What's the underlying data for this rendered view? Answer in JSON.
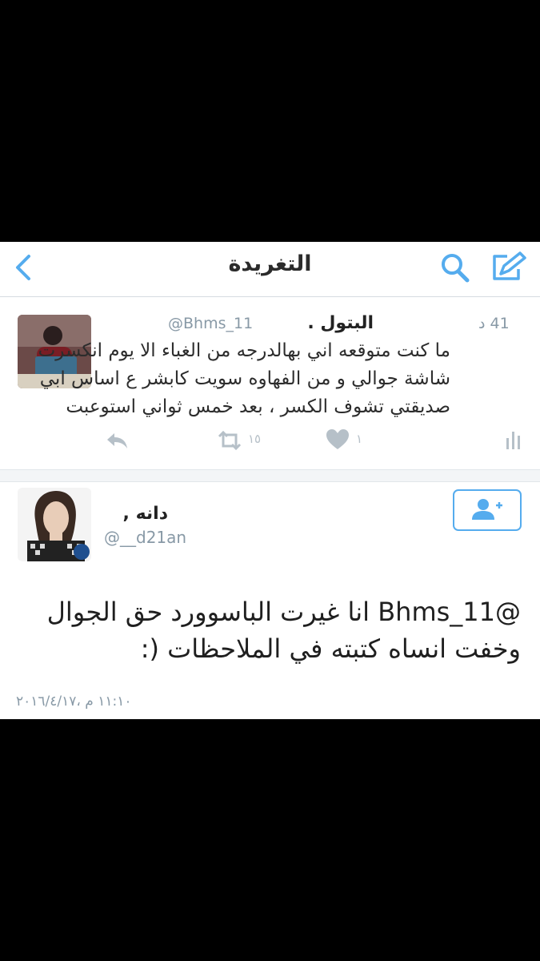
{
  "header": {
    "title": "التغريدة"
  },
  "timeline_tweet": {
    "time": "41 د",
    "handle": "@Bhms_11",
    "name": "البتول .",
    "text": "ما كنت متوقعه اني بهالدرجه من الغباء الا يوم انكسرت شاشة جوالي و من الفهاوه سويت كابشر ع اساس ابي صديقتي تشوف الكسر ، بعد خمس ثواني استوعبت",
    "retweet_count": "١٥",
    "like_count": "١"
  },
  "detail_tweet": {
    "name": "دانه ,",
    "handle": "@__d21an",
    "text": "@Bhms_11 انا غيرت الباسوورد حق الجوال وخفت انساه كتبته في الملاحظات (:",
    "timestamp": "١١:١٠ م ،٢٠١٦/٤/١٧"
  },
  "icons": {
    "back": "chevron-left-icon",
    "search": "search-icon",
    "compose": "compose-icon",
    "reply": "reply-icon",
    "retweet": "retweet-icon",
    "like": "heart-icon",
    "analytics": "analytics-icon",
    "follow": "add-user-icon"
  },
  "colors": {
    "accent": "#55acee",
    "muted": "#8899a6"
  }
}
